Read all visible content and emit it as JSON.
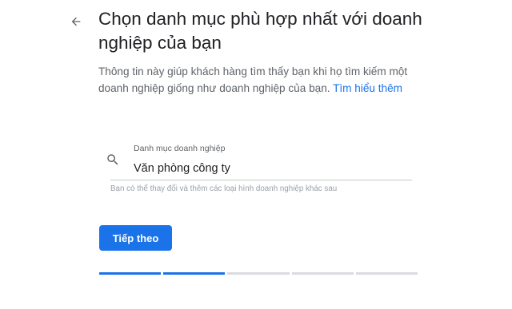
{
  "header": {
    "back_icon": "arrow-left-icon",
    "title": "Chọn danh mục phù hợp nhất với doanh nghiệp của bạn"
  },
  "description": {
    "text": "Thông tin này giúp khách hàng tìm thấy bạn khi họ tìm kiếm một doanh nghiệp giống như doanh nghiệp của bạn. ",
    "link_label": "Tìm hiểu thêm"
  },
  "category_field": {
    "icon": "search-icon",
    "label": "Danh mục doanh nghiệp",
    "value": "Văn phòng công ty",
    "helper": "Bạn có thể thay đổi và thêm các loại hình doanh nghiệp khác sau"
  },
  "actions": {
    "next_label": "Tiếp theo"
  },
  "progress": {
    "total_steps": 5,
    "completed_steps": 2
  },
  "colors": {
    "accent": "#1a73e8",
    "title_text": "#202124",
    "body_text": "#5f6368",
    "inactive_progress": "#dadce0"
  }
}
